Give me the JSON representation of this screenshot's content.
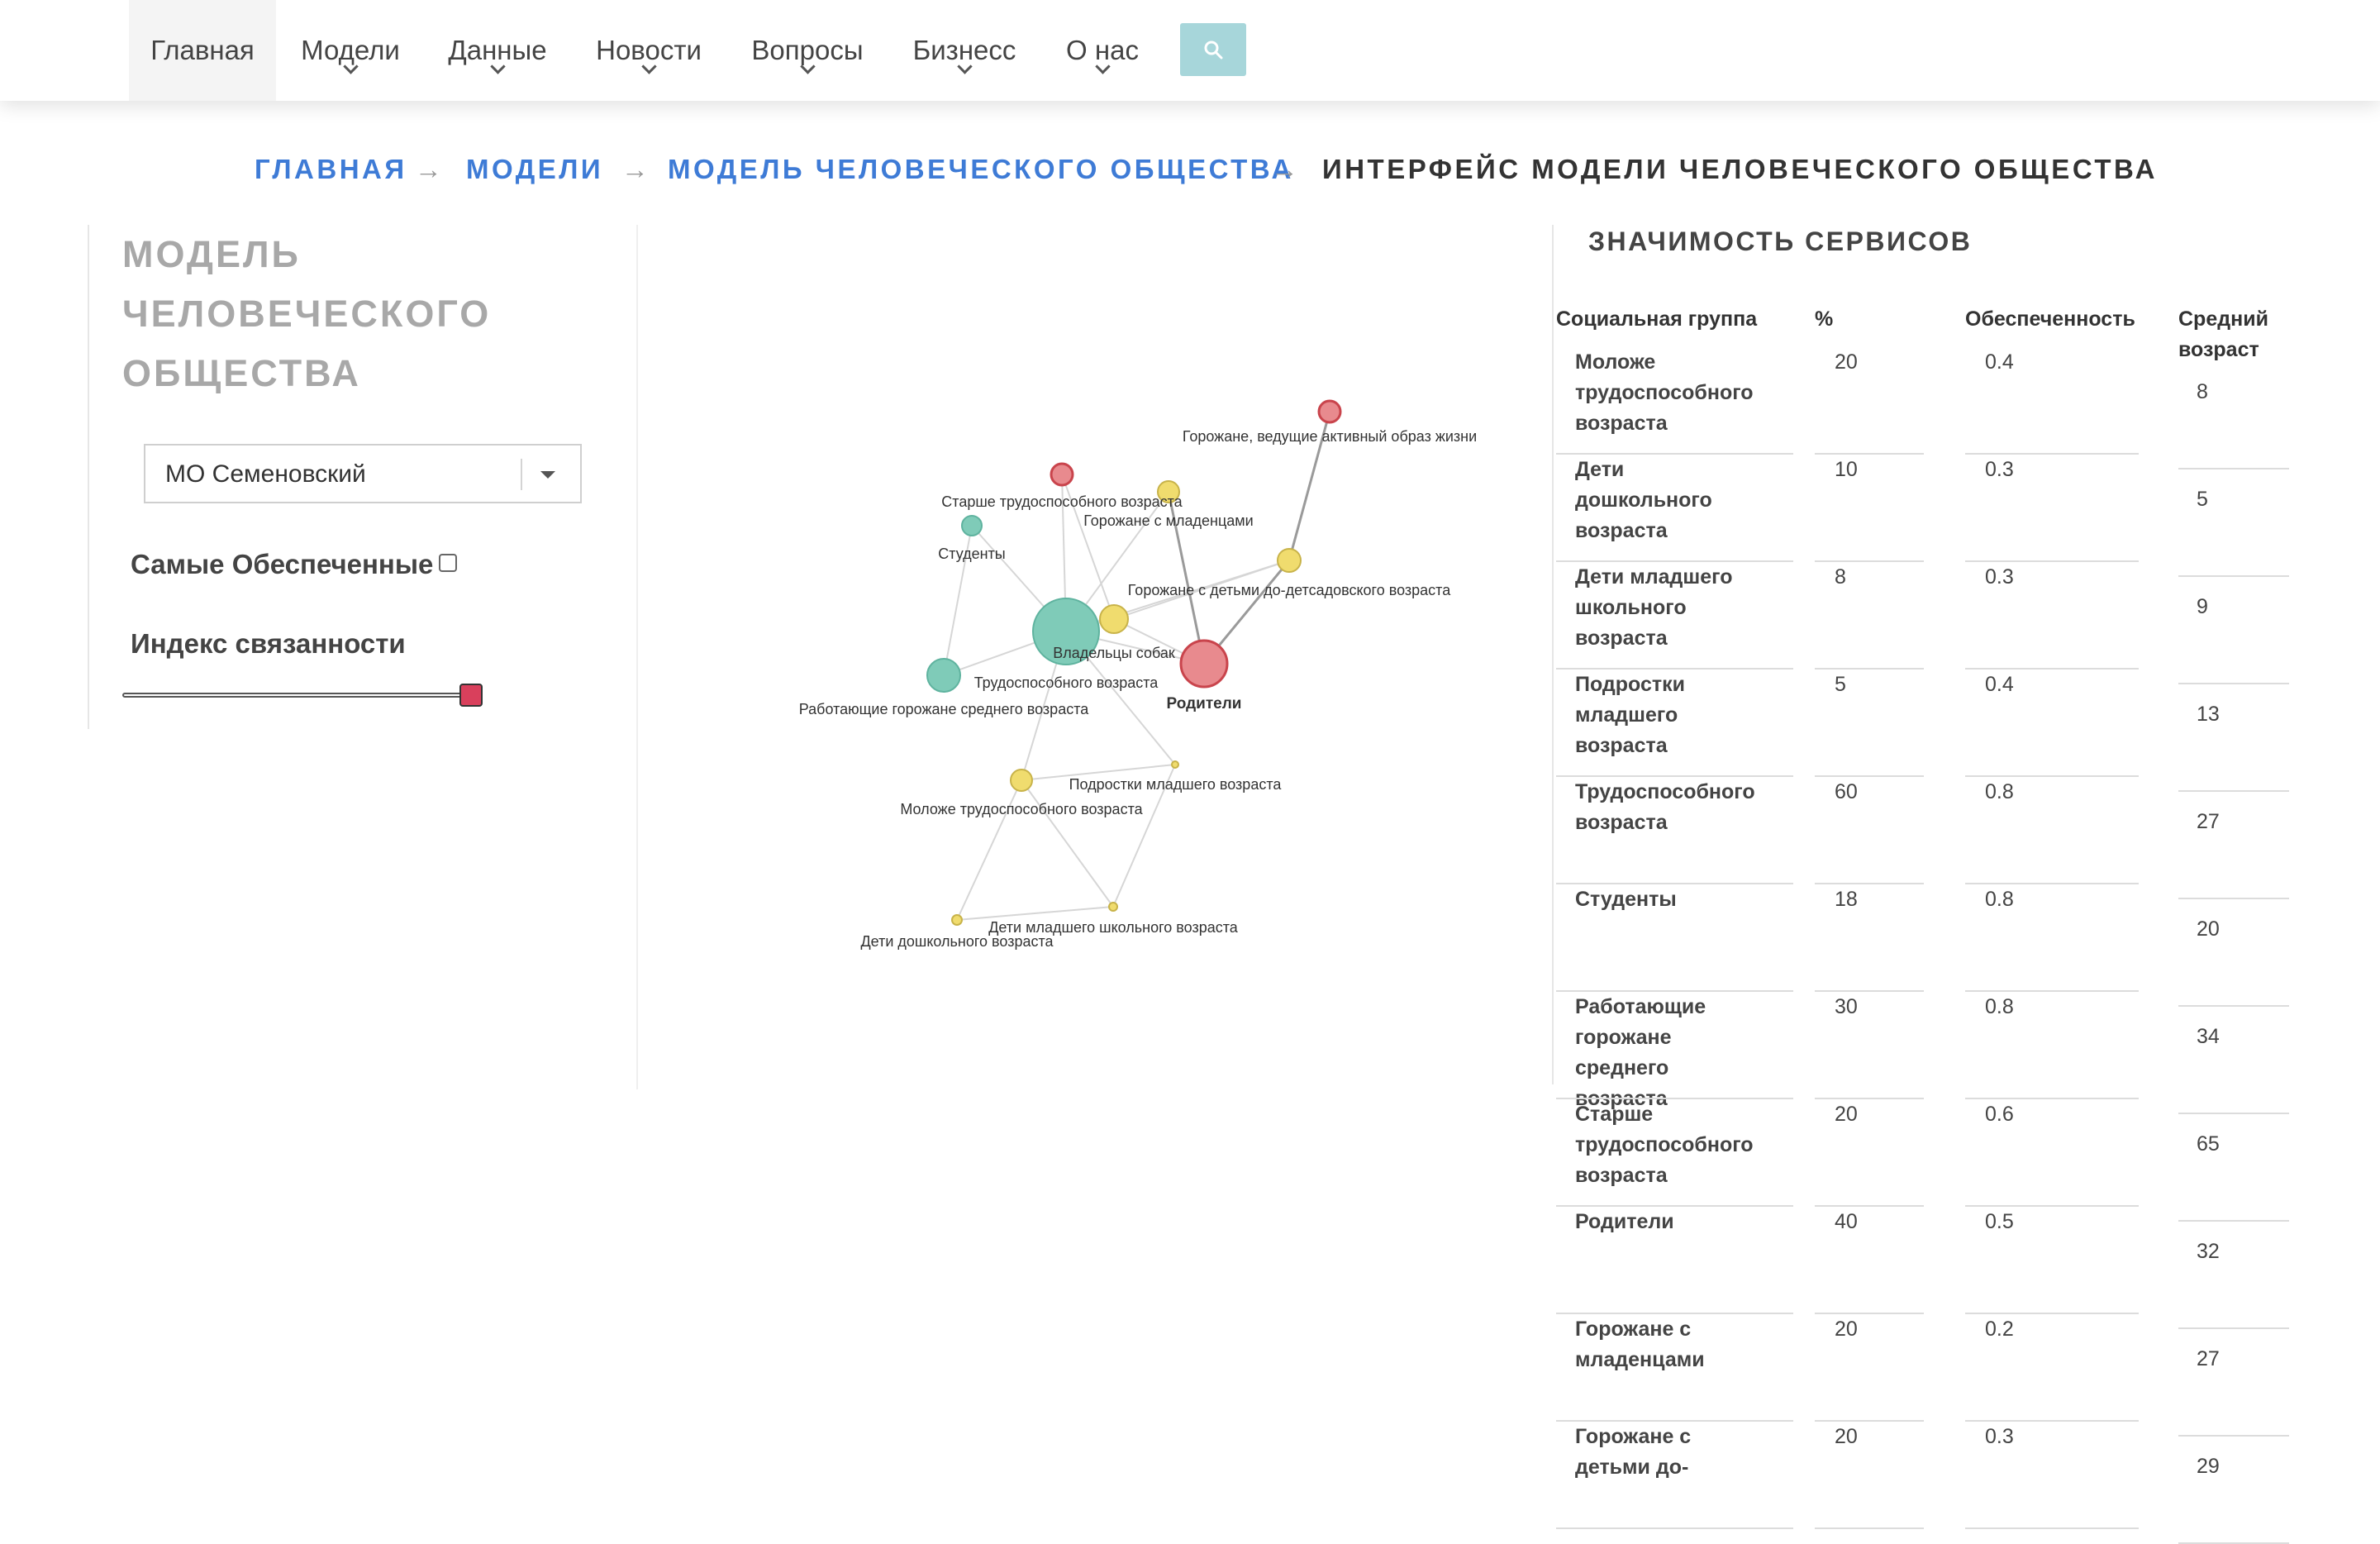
{
  "nav": {
    "items": [
      {
        "label": "Главная",
        "dropdown": false,
        "active": true
      },
      {
        "label": "Модели",
        "dropdown": true
      },
      {
        "label": "Данные",
        "dropdown": true
      },
      {
        "label": "Новости",
        "dropdown": true
      },
      {
        "label": "Вопросы",
        "dropdown": true
      },
      {
        "label": "Бизнесс",
        "dropdown": true
      },
      {
        "label": "О нас",
        "dropdown": true
      }
    ],
    "search_icon": "search-icon"
  },
  "breadcrumb": {
    "links": [
      "Главная",
      "Модели",
      "Модель человеческого общества"
    ],
    "separator": "→",
    "current": "Интерфейс модели человеческого общества"
  },
  "left_panel": {
    "title_lines": [
      "Модель",
      "человеческого",
      "общества"
    ],
    "select_value": "МО Семеновский",
    "checkbox_label": "Самые Обеспеченные",
    "checkbox_checked": false,
    "slider_label": "Индекс связанности",
    "slider_value": 1.0
  },
  "graph": {
    "colors": {
      "teal": "#7fcbb8",
      "yellow": "#f0dc6e",
      "red": "#e88a8e",
      "red_stroke": "#c9444c",
      "yellow_stroke": "#c8b34a",
      "teal_stroke": "#5fb39f"
    },
    "nodes": [
      {
        "id": "healthy",
        "label": "Горожане, ведущие активный образ жизни",
        "color": "red"
      },
      {
        "id": "elder",
        "label": "Старше трудоспособного возраста",
        "color": "red"
      },
      {
        "id": "infants",
        "label": "Горожане с младенцами",
        "color": "yellow"
      },
      {
        "id": "students",
        "label": "Студенты",
        "color": "teal"
      },
      {
        "id": "kinder",
        "label": "Горожане с детьми до-детсадовского возраста",
        "color": "yellow"
      },
      {
        "id": "working_age",
        "label": "Трудоспособного возраста",
        "color": "teal"
      },
      {
        "id": "dogs",
        "label": "Владельцы собак",
        "color": "yellow"
      },
      {
        "id": "parents",
        "label": "Родители",
        "color": "red",
        "bold": true
      },
      {
        "id": "workers_mid",
        "label": "Работающие горожане среднего возраста",
        "color": "teal"
      },
      {
        "id": "teens",
        "label": "Подростки младшего возраста",
        "color": "yellow"
      },
      {
        "id": "young",
        "label": "Моложе трудоспособного возраста",
        "color": "yellow"
      },
      {
        "id": "school",
        "label": "Дети младшего школьного возраста",
        "color": "yellow"
      },
      {
        "id": "preschool",
        "label": "Дети дошкольного возраста",
        "color": "yellow"
      }
    ]
  },
  "table": {
    "title": "Значимость сервисов",
    "headers": {
      "group": "Социальная группа",
      "percent": "%",
      "provision": "Обеспеченность",
      "age": "Средний возраст"
    },
    "rows": [
      {
        "group": "Моложе трудоспособного возраста",
        "percent": "20",
        "provision": "0.4",
        "age": "8"
      },
      {
        "group": "Дети дошкольного возраста",
        "percent": "10",
        "provision": "0.3",
        "age": "5"
      },
      {
        "group": "Дети младшего школьного возраста",
        "percent": "8",
        "provision": "0.3",
        "age": "9"
      },
      {
        "group": "Подростки младшего возраста",
        "percent": "5",
        "provision": "0.4",
        "age": "13"
      },
      {
        "group": "Трудоспособного возраста",
        "percent": "60",
        "provision": "0.8",
        "age": "27"
      },
      {
        "group": "Студенты",
        "percent": "18",
        "provision": "0.8",
        "age": "20"
      },
      {
        "group": "Работающие горожане среднего возраста",
        "percent": "30",
        "provision": "0.8",
        "age": "34"
      },
      {
        "group": "Старше трудоспособного возраста",
        "percent": "20",
        "provision": "0.6",
        "age": "65"
      },
      {
        "group": "Родители",
        "percent": "40",
        "provision": "0.5",
        "age": "32"
      },
      {
        "group": "Горожане с младенцами",
        "percent": "20",
        "provision": "0.2",
        "age": "27"
      },
      {
        "group": "Горожане с детьми до-",
        "percent": "20",
        "provision": "0.3",
        "age": "29"
      }
    ]
  }
}
